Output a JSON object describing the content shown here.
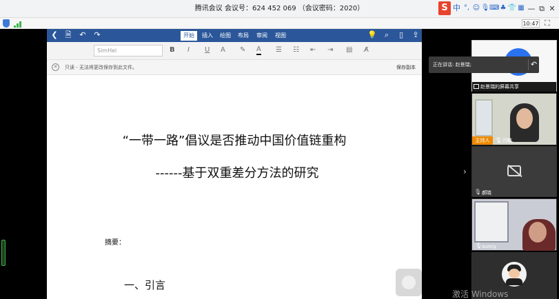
{
  "titlebar": {
    "title": "腾讯会议 会议号：624 452 069 （会议密码：2020）",
    "ime_label": "S",
    "ime_mode": "中",
    "controls": {
      "menu": "≡",
      "minimize": "—",
      "restore": "⧉",
      "close": "✕"
    }
  },
  "status": {
    "time": "10:47"
  },
  "word": {
    "tabs": [
      "开始",
      "插入",
      "绘图",
      "布局",
      "审阅",
      "视图"
    ],
    "active_tab": 0,
    "font": "SimHei",
    "readonly_text": "只读 - 无法将更改保存到此文件。",
    "save_copy": "保存副本",
    "format_buttons": {
      "bold": "B",
      "italic": "I",
      "underline": "U",
      "fontsize": "A"
    }
  },
  "document": {
    "title": "“一带一路”倡议是否推动中国价值链重构",
    "subtitle": "------基于双重差分方法的研究",
    "abstract_label": "摘要：",
    "section1": "一、引言"
  },
  "meeting": {
    "speaking": "正在讲话: 赵景瑞;",
    "participants": [
      {
        "name": "赵景瑞的屏幕共享"
      },
      {
        "name": "闫敏",
        "role": "主持人"
      },
      {
        "name": "郝晓"
      },
      {
        "name": "sunny"
      },
      {
        "name": ""
      }
    ]
  },
  "watermark": "激活 Windows",
  "colors": {
    "word_blue": "#2b579a",
    "host_orange": "#f08a00",
    "tencent_blue": "#2b72ee"
  }
}
